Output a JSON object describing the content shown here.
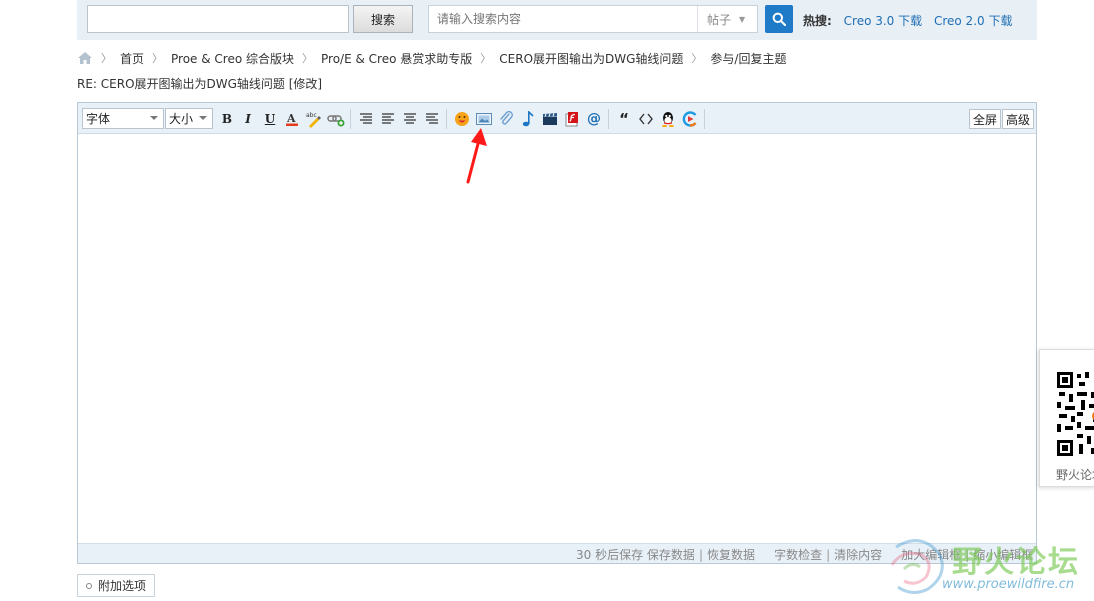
{
  "top_bar": {
    "search_button_label": "搜索",
    "search_placeholder": "请输入搜索内容",
    "search_type": "帖子",
    "hot_label": "热搜:",
    "hot_links": [
      "Creo 3.0 下载",
      "Creo 2.0 下载"
    ]
  },
  "breadcrumb": {
    "items": [
      "首页",
      "Proe & Creo 综合版块",
      "Pro/E & Creo 悬赏求助专版",
      "CERO展开图输出为DWG轴线问题",
      "参与/回复主题"
    ]
  },
  "post": {
    "title": "RE: CERO展开图输出为DWG轴线问题 [修改]"
  },
  "editor": {
    "font_select": "字体",
    "size_select": "大小",
    "bold_label": "B",
    "italic_label": "I",
    "underline_label": "U",
    "fullscreen_label": "全屏",
    "advanced_label": "高级",
    "status": {
      "autosave": "30 秒后保存",
      "save_data": "保存数据",
      "restore_data": "恢复数据",
      "word_check": "字数检查",
      "clear_content": "清除内容",
      "enlarge_editor": "加大编辑框",
      "shrink_editor": "缩小编辑框"
    }
  },
  "attach": {
    "label": "附加选项"
  },
  "qr_panel": {
    "label": "野火论坛"
  },
  "watermark": {
    "text": "野火论坛",
    "url": "www.proewildfire.cn"
  },
  "colors": {
    "link": "#1f6fb5",
    "search_button": "#1f7ac7",
    "toolbar_bg": "#e9f1f8",
    "arrow": "#ff1a1a"
  }
}
